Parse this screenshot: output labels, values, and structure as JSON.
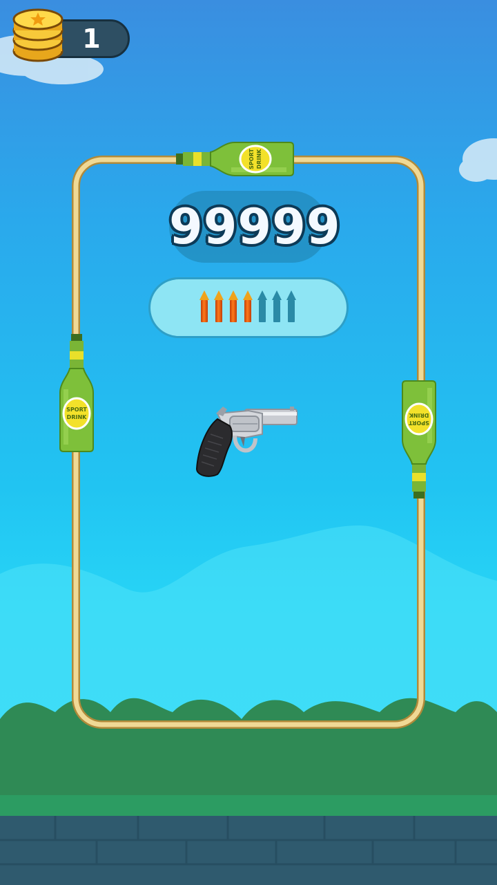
{
  "hud": {
    "coin_count": "1",
    "coin_icon": "gold-coin-stack-icon"
  },
  "game": {
    "score": "99999",
    "ammo": {
      "total": 7,
      "loaded": 4
    },
    "bottles": [
      {
        "position": "top",
        "label_line1": "SPORT",
        "label_line2": "DRINK"
      },
      {
        "position": "left",
        "label_line1": "SPORT",
        "label_line2": "DRINK"
      },
      {
        "position": "right",
        "label_line1": "SPORT",
        "label_line2": "DRINK"
      }
    ],
    "weapon": "revolver"
  },
  "colors": {
    "rail": "#e8cf86",
    "bottle_green": "#7ec03a",
    "label_yellow": "#f3e12a",
    "bullet_full": "#ff7a1a",
    "bullet_empty": "#2a8aa6"
  }
}
